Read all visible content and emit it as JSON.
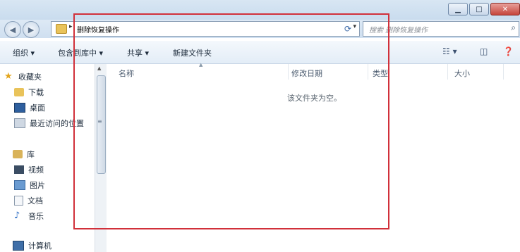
{
  "window": {
    "minimize": "▁",
    "maximize": "□",
    "close": "✕"
  },
  "nav": {
    "back_icon": "arrow-left",
    "forward_icon": "arrow-right",
    "address_path": "删除恢复操作",
    "search_placeholder": "搜索 删除恢复操作"
  },
  "toolbar": {
    "organize": "组织 ▾",
    "include_library": "包含到库中 ▾",
    "share": "共享 ▾",
    "new_folder": "新建文件夹"
  },
  "sidebar": {
    "favorites": "收藏夹",
    "downloads": "下载",
    "desktop": "桌面",
    "recent": "最近访问的位置",
    "libraries": "库",
    "videos": "视频",
    "pictures": "图片",
    "documents": "文档",
    "music": "音乐",
    "computer": "计算机"
  },
  "columns": {
    "name": "名称",
    "date": "修改日期",
    "type": "类型",
    "size": "大小"
  },
  "empty_message": "该文件夹为空。",
  "colors": {
    "highlight_box": "#d1303a"
  }
}
